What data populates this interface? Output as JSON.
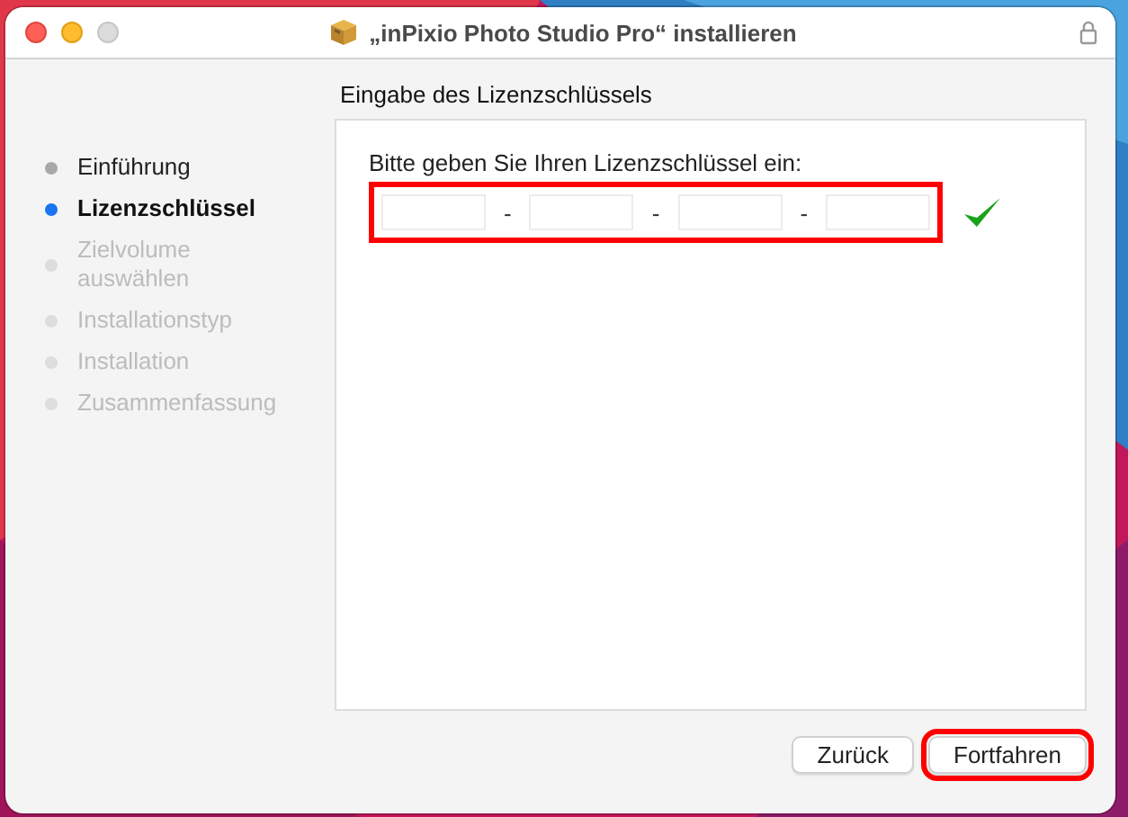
{
  "window": {
    "title": "„inPixio Photo Studio Pro“ installieren"
  },
  "heading": "Eingabe des Lizenzschlüssels",
  "steps": [
    {
      "label": "Einführung",
      "completed": true,
      "selected": false
    },
    {
      "label": "Lizenzschlüssel",
      "completed": false,
      "selected": true
    },
    {
      "label": "Zielvolume auswählen",
      "completed": false,
      "selected": false
    },
    {
      "label": "Installationstyp",
      "completed": false,
      "selected": false
    },
    {
      "label": "Installation",
      "completed": false,
      "selected": false
    },
    {
      "label": "Zusammenfassung",
      "completed": false,
      "selected": false
    }
  ],
  "license": {
    "prompt": "Bitte geben Sie Ihren Lizenzschlüssel ein:",
    "separators": [
      "-",
      "-",
      "-"
    ],
    "highlighted": true,
    "valid": true
  },
  "buttons": [
    {
      "label": "Zurück",
      "highlighted": false
    },
    {
      "label": "Fortfahren",
      "highlighted": true
    }
  ]
}
